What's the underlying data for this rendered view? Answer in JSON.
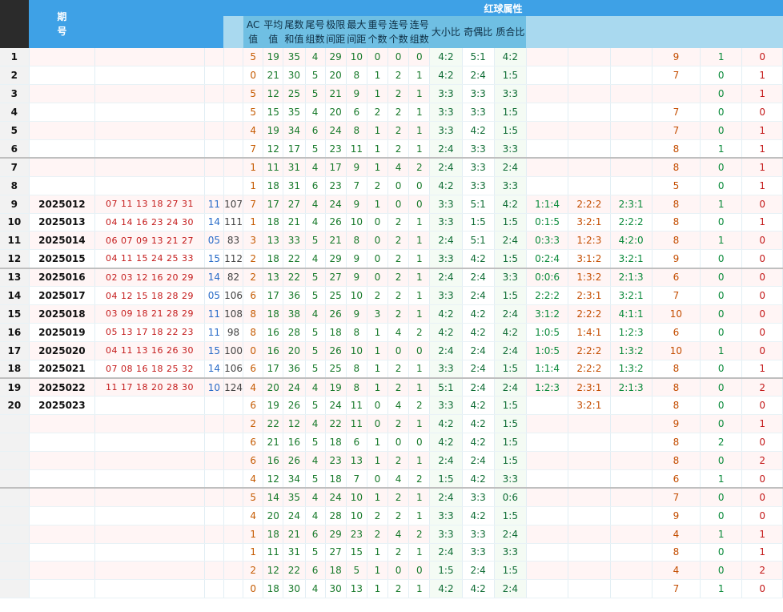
{
  "header": {
    "period_label": "期号",
    "red_attr_label": "红球属性",
    "sub": [
      "AC值",
      "平均值",
      "尾数和值",
      "尾号组数",
      "极限间距",
      "最大间距",
      "重号个数",
      "连号个数",
      "连号组数",
      "大小比",
      "奇偶比",
      "质合比"
    ]
  },
  "rows": [
    {
      "seq": "1",
      "period": "",
      "reds": "",
      "blue": "",
      "sum": "",
      "ac": "5",
      "avg": "19",
      "tail": "35",
      "tgroups": "4",
      "range": "29",
      "maxgap": "10",
      "rep": "0",
      "consec": "0",
      "cgroups": "0",
      "big": "4:2",
      "odd": "5:1",
      "prime": "4:2",
      "z1": "",
      "z2": "",
      "z3": "",
      "c1": "9",
      "c2": "1",
      "c3": "0"
    },
    {
      "seq": "2",
      "period": "",
      "reds": "",
      "blue": "",
      "sum": "",
      "ac": "0",
      "avg": "21",
      "tail": "30",
      "tgroups": "5",
      "range": "20",
      "maxgap": "8",
      "rep": "1",
      "consec": "2",
      "cgroups": "1",
      "big": "4:2",
      "odd": "2:4",
      "prime": "1:5",
      "z1": "",
      "z2": "",
      "z3": "",
      "c1": "7",
      "c2": "0",
      "c3": "1"
    },
    {
      "seq": "3",
      "period": "",
      "reds": "",
      "blue": "",
      "sum": "",
      "ac": "5",
      "avg": "12",
      "tail": "25",
      "tgroups": "5",
      "range": "21",
      "maxgap": "9",
      "rep": "1",
      "consec": "2",
      "cgroups": "1",
      "big": "3:3",
      "odd": "3:3",
      "prime": "3:3",
      "z1": "",
      "z2": "",
      "z3": "",
      "c1": "",
      "c2": "0",
      "c3": "1"
    },
    {
      "seq": "4",
      "period": "",
      "reds": "",
      "blue": "",
      "sum": "",
      "ac": "5",
      "avg": "15",
      "tail": "35",
      "tgroups": "4",
      "range": "20",
      "maxgap": "6",
      "rep": "2",
      "consec": "2",
      "cgroups": "1",
      "big": "3:3",
      "odd": "3:3",
      "prime": "1:5",
      "z1": "",
      "z2": "",
      "z3": "",
      "c1": "7",
      "c2": "0",
      "c3": "0"
    },
    {
      "seq": "5",
      "period": "",
      "reds": "",
      "blue": "",
      "sum": "",
      "ac": "4",
      "avg": "19",
      "tail": "34",
      "tgroups": "6",
      "range": "24",
      "maxgap": "8",
      "rep": "1",
      "consec": "2",
      "cgroups": "1",
      "big": "3:3",
      "odd": "4:2",
      "prime": "1:5",
      "z1": "",
      "z2": "",
      "z3": "",
      "c1": "7",
      "c2": "0",
      "c3": "1"
    },
    {
      "seq": "6",
      "period": "",
      "reds": "",
      "blue": "",
      "sum": "",
      "ac": "7",
      "avg": "12",
      "tail": "17",
      "tgroups": "5",
      "range": "23",
      "maxgap": "11",
      "rep": "1",
      "consec": "2",
      "cgroups": "1",
      "big": "2:4",
      "odd": "3:3",
      "prime": "3:3",
      "z1": "",
      "z2": "",
      "z3": "",
      "c1": "8",
      "c2": "1",
      "c3": "1"
    },
    {
      "seq": "7",
      "period": "",
      "reds": "",
      "blue": "",
      "sum": "",
      "ac": "1",
      "avg": "11",
      "tail": "31",
      "tgroups": "4",
      "range": "17",
      "maxgap": "9",
      "rep": "1",
      "consec": "4",
      "cgroups": "2",
      "big": "2:4",
      "odd": "3:3",
      "prime": "2:4",
      "z1": "",
      "z2": "",
      "z3": "",
      "c1": "8",
      "c2": "0",
      "c3": "1"
    },
    {
      "seq": "8",
      "period": "",
      "reds": "",
      "blue": "",
      "sum": "",
      "ac": "1",
      "avg": "18",
      "tail": "31",
      "tgroups": "6",
      "range": "23",
      "maxgap": "7",
      "rep": "2",
      "consec": "0",
      "cgroups": "0",
      "big": "4:2",
      "odd": "3:3",
      "prime": "3:3",
      "z1": "",
      "z2": "",
      "z3": "",
      "c1": "5",
      "c2": "0",
      "c3": "1"
    },
    {
      "seq": "9",
      "period": "2025012",
      "reds": "07 11 13 18 27 31",
      "blue": "11",
      "sum": "107",
      "ac": "7",
      "avg": "17",
      "tail": "27",
      "tgroups": "4",
      "range": "24",
      "maxgap": "9",
      "rep": "1",
      "consec": "0",
      "cgroups": "0",
      "big": "3:3",
      "odd": "5:1",
      "prime": "4:2",
      "z1": "1:1:4",
      "z2": "2:2:2",
      "z3": "2:3:1",
      "c1": "8",
      "c2": "1",
      "c3": "0"
    },
    {
      "seq": "10",
      "period": "2025013",
      "reds": "04 14 16 23 24 30",
      "blue": "14",
      "sum": "111",
      "ac": "1",
      "avg": "18",
      "tail": "21",
      "tgroups": "4",
      "range": "26",
      "maxgap": "10",
      "rep": "0",
      "consec": "2",
      "cgroups": "1",
      "big": "3:3",
      "odd": "1:5",
      "prime": "1:5",
      "z1": "0:1:5",
      "z2": "3:2:1",
      "z3": "2:2:2",
      "c1": "8",
      "c2": "0",
      "c3": "1"
    },
    {
      "seq": "11",
      "period": "2025014",
      "reds": "06 07 09 13 21 27",
      "blue": "05",
      "sum": "83",
      "ac": "3",
      "avg": "13",
      "tail": "33",
      "tgroups": "5",
      "range": "21",
      "maxgap": "8",
      "rep": "0",
      "consec": "2",
      "cgroups": "1",
      "big": "2:4",
      "odd": "5:1",
      "prime": "2:4",
      "z1": "0:3:3",
      "z2": "1:2:3",
      "z3": "4:2:0",
      "c1": "8",
      "c2": "1",
      "c3": "0"
    },
    {
      "seq": "12",
      "period": "2025015",
      "reds": "04 11 15 24 25 33",
      "blue": "15",
      "sum": "112",
      "ac": "2",
      "avg": "18",
      "tail": "22",
      "tgroups": "4",
      "range": "29",
      "maxgap": "9",
      "rep": "0",
      "consec": "2",
      "cgroups": "1",
      "big": "3:3",
      "odd": "4:2",
      "prime": "1:5",
      "z1": "0:2:4",
      "z2": "3:1:2",
      "z3": "3:2:1",
      "c1": "9",
      "c2": "0",
      "c3": "0"
    },
    {
      "seq": "13",
      "period": "2025016",
      "reds": "02 03 12 16 20 29",
      "blue": "14",
      "sum": "82",
      "ac": "2",
      "avg": "13",
      "tail": "22",
      "tgroups": "5",
      "range": "27",
      "maxgap": "9",
      "rep": "0",
      "consec": "2",
      "cgroups": "1",
      "big": "2:4",
      "odd": "2:4",
      "prime": "3:3",
      "z1": "0:0:6",
      "z2": "1:3:2",
      "z3": "2:1:3",
      "c1": "6",
      "c2": "0",
      "c3": "0"
    },
    {
      "seq": "14",
      "period": "2025017",
      "reds": "04 12 15 18 28 29",
      "blue": "05",
      "sum": "106",
      "ac": "6",
      "avg": "17",
      "tail": "36",
      "tgroups": "5",
      "range": "25",
      "maxgap": "10",
      "rep": "2",
      "consec": "2",
      "cgroups": "1",
      "big": "3:3",
      "odd": "2:4",
      "prime": "1:5",
      "z1": "2:2:2",
      "z2": "2:3:1",
      "z3": "3:2:1",
      "c1": "7",
      "c2": "0",
      "c3": "0"
    },
    {
      "seq": "15",
      "period": "2025018",
      "reds": "03 09 18 21 28 29",
      "blue": "11",
      "sum": "108",
      "ac": "8",
      "avg": "18",
      "tail": "38",
      "tgroups": "4",
      "range": "26",
      "maxgap": "9",
      "rep": "3",
      "consec": "2",
      "cgroups": "1",
      "big": "4:2",
      "odd": "4:2",
      "prime": "2:4",
      "z1": "3:1:2",
      "z2": "2:2:2",
      "z3": "4:1:1",
      "c1": "10",
      "c2": "0",
      "c3": "0"
    },
    {
      "seq": "16",
      "period": "2025019",
      "reds": "05 13 17 18 22 23",
      "blue": "11",
      "sum": "98",
      "ac": "8",
      "avg": "16",
      "tail": "28",
      "tgroups": "5",
      "range": "18",
      "maxgap": "8",
      "rep": "1",
      "consec": "4",
      "cgroups": "2",
      "big": "4:2",
      "odd": "4:2",
      "prime": "4:2",
      "z1": "1:0:5",
      "z2": "1:4:1",
      "z3": "1:2:3",
      "c1": "6",
      "c2": "0",
      "c3": "0"
    },
    {
      "seq": "17",
      "period": "2025020",
      "reds": "04 11 13 16 26 30",
      "blue": "15",
      "sum": "100",
      "ac": "0",
      "avg": "16",
      "tail": "20",
      "tgroups": "5",
      "range": "26",
      "maxgap": "10",
      "rep": "1",
      "consec": "0",
      "cgroups": "0",
      "big": "2:4",
      "odd": "2:4",
      "prime": "2:4",
      "z1": "1:0:5",
      "z2": "2:2:2",
      "z3": "1:3:2",
      "c1": "10",
      "c2": "1",
      "c3": "0"
    },
    {
      "seq": "18",
      "period": "2025021",
      "reds": "07 08 16 18 25 32",
      "blue": "14",
      "sum": "106",
      "ac": "6",
      "avg": "17",
      "tail": "36",
      "tgroups": "5",
      "range": "25",
      "maxgap": "8",
      "rep": "1",
      "consec": "2",
      "cgroups": "1",
      "big": "3:3",
      "odd": "2:4",
      "prime": "1:5",
      "z1": "1:1:4",
      "z2": "2:2:2",
      "z3": "1:3:2",
      "c1": "8",
      "c2": "0",
      "c3": "1"
    },
    {
      "seq": "19",
      "period": "2025022",
      "reds": "11 17 18 20 28 30",
      "blue": "10",
      "sum": "124",
      "ac": "4",
      "avg": "20",
      "tail": "24",
      "tgroups": "4",
      "range": "19",
      "maxgap": "8",
      "rep": "1",
      "consec": "2",
      "cgroups": "1",
      "big": "5:1",
      "odd": "2:4",
      "prime": "2:4",
      "z1": "1:2:3",
      "z2": "2:3:1",
      "z3": "2:1:3",
      "c1": "8",
      "c2": "0",
      "c3": "2"
    },
    {
      "seq": "20",
      "period": "2025023",
      "reds": "",
      "blue": "",
      "sum": "",
      "ac": "6",
      "avg": "19",
      "tail": "26",
      "tgroups": "5",
      "range": "24",
      "maxgap": "11",
      "rep": "0",
      "consec": "4",
      "cgroups": "2",
      "big": "3:3",
      "odd": "4:2",
      "prime": "1:5",
      "z1": "",
      "z2": "3:2:1",
      "z3": "",
      "c1": "8",
      "c2": "0",
      "c3": "0"
    },
    {
      "seq": "",
      "period": "",
      "reds": "",
      "blue": "",
      "sum": "",
      "ac": "2",
      "avg": "22",
      "tail": "12",
      "tgroups": "4",
      "range": "22",
      "maxgap": "11",
      "rep": "0",
      "consec": "2",
      "cgroups": "1",
      "big": "4:2",
      "odd": "4:2",
      "prime": "1:5",
      "z1": "",
      "z2": "",
      "z3": "",
      "c1": "9",
      "c2": "0",
      "c3": "1"
    },
    {
      "seq": "",
      "period": "",
      "reds": "",
      "blue": "",
      "sum": "",
      "ac": "6",
      "avg": "21",
      "tail": "16",
      "tgroups": "5",
      "range": "18",
      "maxgap": "6",
      "rep": "1",
      "consec": "0",
      "cgroups": "0",
      "big": "4:2",
      "odd": "4:2",
      "prime": "1:5",
      "z1": "",
      "z2": "",
      "z3": "",
      "c1": "8",
      "c2": "2",
      "c3": "0"
    },
    {
      "seq": "",
      "period": "",
      "reds": "",
      "blue": "",
      "sum": "",
      "ac": "6",
      "avg": "16",
      "tail": "26",
      "tgroups": "4",
      "range": "23",
      "maxgap": "13",
      "rep": "1",
      "consec": "2",
      "cgroups": "1",
      "big": "2:4",
      "odd": "2:4",
      "prime": "1:5",
      "z1": "",
      "z2": "",
      "z3": "",
      "c1": "8",
      "c2": "0",
      "c3": "2"
    },
    {
      "seq": "",
      "period": "",
      "reds": "",
      "blue": "",
      "sum": "",
      "ac": "4",
      "avg": "12",
      "tail": "34",
      "tgroups": "5",
      "range": "18",
      "maxgap": "7",
      "rep": "0",
      "consec": "4",
      "cgroups": "2",
      "big": "1:5",
      "odd": "4:2",
      "prime": "3:3",
      "z1": "",
      "z2": "",
      "z3": "",
      "c1": "6",
      "c2": "1",
      "c3": "0"
    },
    {
      "seq": "",
      "period": "",
      "reds": "",
      "blue": "",
      "sum": "",
      "ac": "5",
      "avg": "14",
      "tail": "35",
      "tgroups": "4",
      "range": "24",
      "maxgap": "10",
      "rep": "1",
      "consec": "2",
      "cgroups": "1",
      "big": "2:4",
      "odd": "3:3",
      "prime": "0:6",
      "z1": "",
      "z2": "",
      "z3": "",
      "c1": "7",
      "c2": "0",
      "c3": "0"
    },
    {
      "seq": "",
      "period": "",
      "reds": "",
      "blue": "",
      "sum": "",
      "ac": "4",
      "avg": "20",
      "tail": "24",
      "tgroups": "4",
      "range": "28",
      "maxgap": "10",
      "rep": "2",
      "consec": "2",
      "cgroups": "1",
      "big": "3:3",
      "odd": "4:2",
      "prime": "1:5",
      "z1": "",
      "z2": "",
      "z3": "",
      "c1": "9",
      "c2": "0",
      "c3": "0"
    },
    {
      "seq": "",
      "period": "",
      "reds": "",
      "blue": "",
      "sum": "",
      "ac": "1",
      "avg": "18",
      "tail": "21",
      "tgroups": "6",
      "range": "29",
      "maxgap": "23",
      "rep": "2",
      "consec": "4",
      "cgroups": "2",
      "big": "3:3",
      "odd": "3:3",
      "prime": "2:4",
      "z1": "",
      "z2": "",
      "z3": "",
      "c1": "4",
      "c2": "1",
      "c3": "1"
    },
    {
      "seq": "",
      "period": "",
      "reds": "",
      "blue": "",
      "sum": "",
      "ac": "1",
      "avg": "11",
      "tail": "31",
      "tgroups": "5",
      "range": "27",
      "maxgap": "15",
      "rep": "1",
      "consec": "2",
      "cgroups": "1",
      "big": "2:4",
      "odd": "3:3",
      "prime": "3:3",
      "z1": "",
      "z2": "",
      "z3": "",
      "c1": "8",
      "c2": "0",
      "c3": "1"
    },
    {
      "seq": "",
      "period": "",
      "reds": "",
      "blue": "",
      "sum": "",
      "ac": "2",
      "avg": "12",
      "tail": "22",
      "tgroups": "6",
      "range": "18",
      "maxgap": "5",
      "rep": "1",
      "consec": "0",
      "cgroups": "0",
      "big": "1:5",
      "odd": "2:4",
      "prime": "1:5",
      "z1": "",
      "z2": "",
      "z3": "",
      "c1": "4",
      "c2": "0",
      "c3": "2"
    },
    {
      "seq": "",
      "period": "",
      "reds": "",
      "blue": "",
      "sum": "",
      "ac": "0",
      "avg": "18",
      "tail": "30",
      "tgroups": "4",
      "range": "30",
      "maxgap": "13",
      "rep": "1",
      "consec": "2",
      "cgroups": "1",
      "big": "4:2",
      "odd": "4:2",
      "prime": "2:4",
      "z1": "",
      "z2": "",
      "z3": "",
      "c1": "7",
      "c2": "1",
      "c3": "0"
    }
  ]
}
